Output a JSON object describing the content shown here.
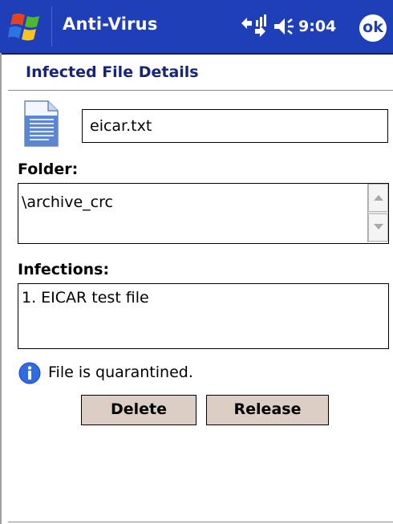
{
  "titlebar": {
    "app_title": "Anti-Virus",
    "clock": "9:04",
    "ok_label": "ok",
    "background_color": "#1f3fb9",
    "icons": [
      "start-menu-icon",
      "signal-icon",
      "volume-icon"
    ]
  },
  "header": {
    "title": "Infected File Details",
    "title_color": "#16257c"
  },
  "file": {
    "icon": "document-icon",
    "name": "eicar.txt"
  },
  "folder": {
    "label": "Folder:",
    "value": "\\archive_crc"
  },
  "infections": {
    "label": "Infections:",
    "items": [
      "1. EICAR test file"
    ]
  },
  "status": {
    "icon": "info-icon",
    "text": "File is quarantined."
  },
  "actions": {
    "delete_label": "Delete",
    "release_label": "Release",
    "button_color": "#dccdc5"
  }
}
